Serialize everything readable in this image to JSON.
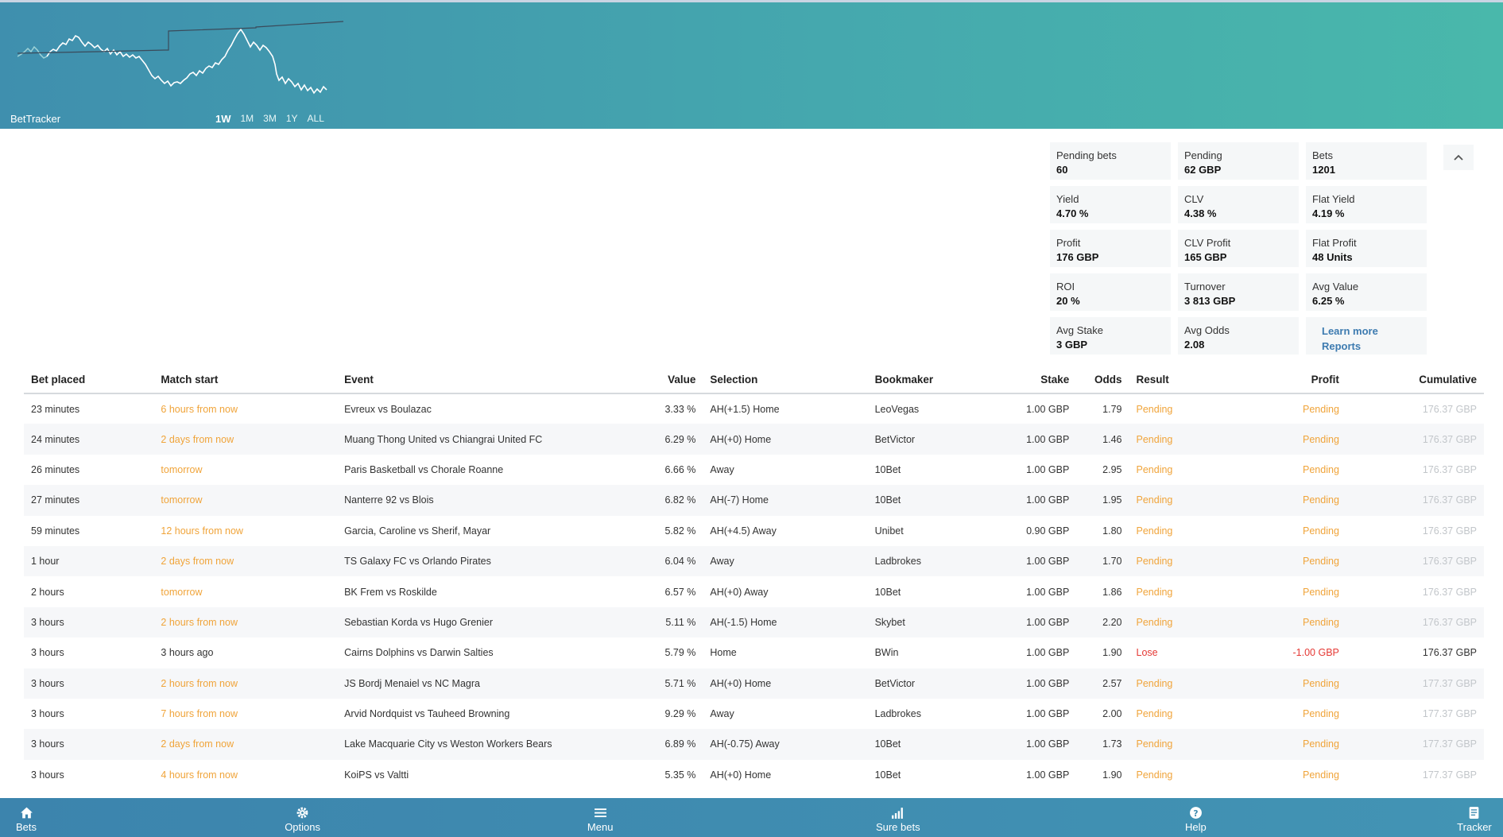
{
  "app": {
    "brand": "BetTracker"
  },
  "header": {
    "ranges": [
      "1W",
      "1M",
      "3M",
      "1Y",
      "ALL"
    ],
    "active_range": "1W",
    "colors": {
      "gradient_start": "#3f8fae",
      "gradient_end": "#49b8ab"
    }
  },
  "stats": [
    {
      "label": "Pending bets",
      "value": "60"
    },
    {
      "label": "Pending",
      "value": "62 GBP"
    },
    {
      "label": "Bets",
      "value": "1201"
    },
    {
      "label": "Yield",
      "value": "4.70 %"
    },
    {
      "label": "CLV",
      "value": "4.38 %"
    },
    {
      "label": "Flat Yield",
      "value": "4.19 %"
    },
    {
      "label": "Profit",
      "value": "176 GBP"
    },
    {
      "label": "CLV Profit",
      "value": "165 GBP"
    },
    {
      "label": "Flat Profit",
      "value": "48 Units"
    },
    {
      "label": "ROI",
      "value": "20 %"
    },
    {
      "label": "Turnover",
      "value": "3 813 GBP"
    },
    {
      "label": "Avg Value",
      "value": "6.25 %"
    },
    {
      "label": "Avg Stake",
      "value": "3 GBP"
    },
    {
      "label": "Avg Odds",
      "value": "2.08"
    }
  ],
  "links": {
    "learn_more": "Learn more",
    "reports": "Reports"
  },
  "table": {
    "headers": [
      "Bet placed",
      "Match start",
      "Event",
      "Value",
      "Selection",
      "Bookmaker",
      "Stake",
      "Odds",
      "Result",
      "Profit",
      "Cumulative"
    ],
    "rows": [
      [
        "23 minutes",
        "6 hours from now",
        "Evreux vs Boulazac",
        "3.33 %",
        "AH(+1.5) Home",
        "LeoVegas",
        "1.00 GBP",
        "1.79",
        "Pending",
        "Pending",
        "176.37 GBP"
      ],
      [
        "24 minutes",
        "2 days from now",
        "Muang Thong United vs Chiangrai United FC",
        "6.29 %",
        "AH(+0) Home",
        "BetVictor",
        "1.00 GBP",
        "1.46",
        "Pending",
        "Pending",
        "176.37 GBP"
      ],
      [
        "26 minutes",
        "tomorrow",
        "Paris Basketball vs Chorale Roanne",
        "6.66 %",
        "Away",
        "10Bet",
        "1.00 GBP",
        "2.95",
        "Pending",
        "Pending",
        "176.37 GBP"
      ],
      [
        "27 minutes",
        "tomorrow",
        "Nanterre 92 vs Blois",
        "6.82 %",
        "AH(-7) Home",
        "10Bet",
        "1.00 GBP",
        "1.95",
        "Pending",
        "Pending",
        "176.37 GBP"
      ],
      [
        "59 minutes",
        "12 hours from now",
        "Garcia, Caroline vs Sherif, Mayar",
        "5.82 %",
        "AH(+4.5) Away",
        "Unibet",
        "0.90 GBP",
        "1.80",
        "Pending",
        "Pending",
        "176.37 GBP"
      ],
      [
        "1 hour",
        "2 days from now",
        "TS Galaxy FC vs Orlando Pirates",
        "6.04 %",
        "Away",
        "Ladbrokes",
        "1.00 GBP",
        "1.70",
        "Pending",
        "Pending",
        "176.37 GBP"
      ],
      [
        "2 hours",
        "tomorrow",
        "BK Frem vs Roskilde",
        "6.57 %",
        "AH(+0) Away",
        "10Bet",
        "1.00 GBP",
        "1.86",
        "Pending",
        "Pending",
        "176.37 GBP"
      ],
      [
        "3 hours",
        "2 hours from now",
        "Sebastian Korda vs Hugo Grenier",
        "5.11 %",
        "AH(-1.5) Home",
        "Skybet",
        "1.00 GBP",
        "2.20",
        "Pending",
        "Pending",
        "176.37 GBP"
      ],
      [
        "3 hours",
        "3 hours ago",
        "Cairns Dolphins vs Darwin Salties",
        "5.79 %",
        "Home",
        "BWin",
        "1.00 GBP",
        "1.90",
        "Lose",
        "-1.00 GBP",
        "176.37 GBP"
      ],
      [
        "3 hours",
        "2 hours from now",
        "JS Bordj Menaiel vs NC Magra",
        "5.71 %",
        "AH(+0) Home",
        "BetVictor",
        "1.00 GBP",
        "2.57",
        "Pending",
        "Pending",
        "177.37 GBP"
      ],
      [
        "3 hours",
        "7 hours from now",
        "Arvid Nordquist vs Tauheed Browning",
        "9.29 %",
        "Away",
        "Ladbrokes",
        "1.00 GBP",
        "2.00",
        "Pending",
        "Pending",
        "177.37 GBP"
      ],
      [
        "3 hours",
        "2 days from now",
        "Lake Macquarie City vs Weston Workers Bears",
        "6.89 %",
        "AH(-0.75) Away",
        "10Bet",
        "1.00 GBP",
        "1.73",
        "Pending",
        "Pending",
        "177.37 GBP"
      ],
      [
        "3 hours",
        "4 hours from now",
        "KoiPS vs Valtti",
        "5.35 %",
        "AH(+0) Home",
        "10Bet",
        "1.00 GBP",
        "1.90",
        "Pending",
        "Pending",
        "177.37 GBP"
      ]
    ]
  },
  "bottom_nav": [
    {
      "label": "Bets",
      "icon": "home-icon"
    },
    {
      "label": "Options",
      "icon": "gear-icon"
    },
    {
      "label": "Menu",
      "icon": "menu-icon"
    },
    {
      "label": "Sure bets",
      "icon": "signal-bars-icon"
    },
    {
      "label": "Help",
      "icon": "help-icon"
    },
    {
      "label": "Tracker",
      "icon": "tracker-icon"
    }
  ]
}
